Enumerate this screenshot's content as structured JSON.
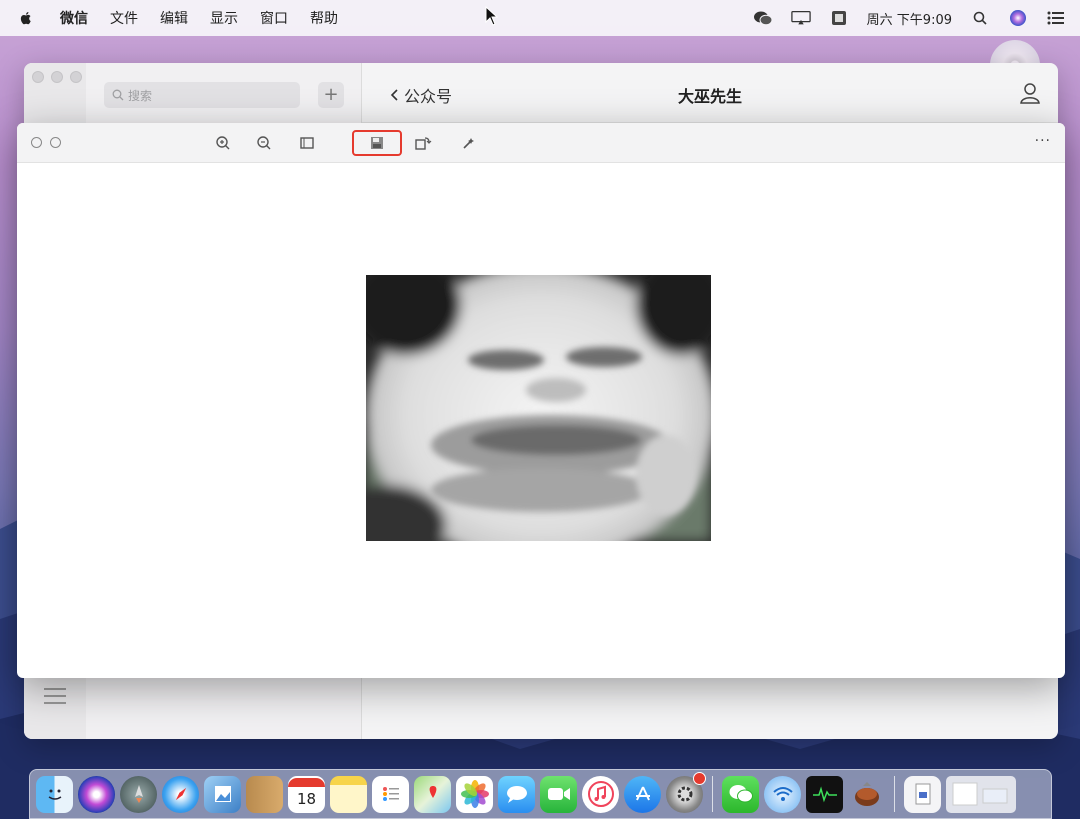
{
  "menubar": {
    "app_name": "微信",
    "items": [
      "文件",
      "编辑",
      "显示",
      "窗口",
      "帮助"
    ],
    "clock": "周六 下午9:09"
  },
  "wechat": {
    "search_placeholder": "搜索",
    "add_label": "+",
    "back_label": "公众号",
    "chat_title": "大巫先生"
  },
  "viewer": {
    "toolbar_icons": [
      "zoom-in-icon",
      "zoom-out-icon",
      "crop-icon",
      "save-icon",
      "rotate-icon",
      "magic-wand-icon"
    ],
    "more_label": "···",
    "highlight_color": "#e53a2e"
  },
  "dock": {
    "apps": [
      "finder-icon",
      "siri-icon",
      "launchpad-icon",
      "safari-icon",
      "preview-icon",
      "contacts-icon",
      "calendar-icon",
      "notes-icon",
      "reminders-icon",
      "maps-icon",
      "photos-icon",
      "messages-icon",
      "facetime-icon",
      "music-icon",
      "app-store-icon",
      "system-preferences-icon",
      "wechat-icon",
      "wifi-icon",
      "activity-monitor-icon",
      "wallet-icon",
      "documents-icon",
      "downloads-icon"
    ],
    "calendar_date": "18"
  }
}
